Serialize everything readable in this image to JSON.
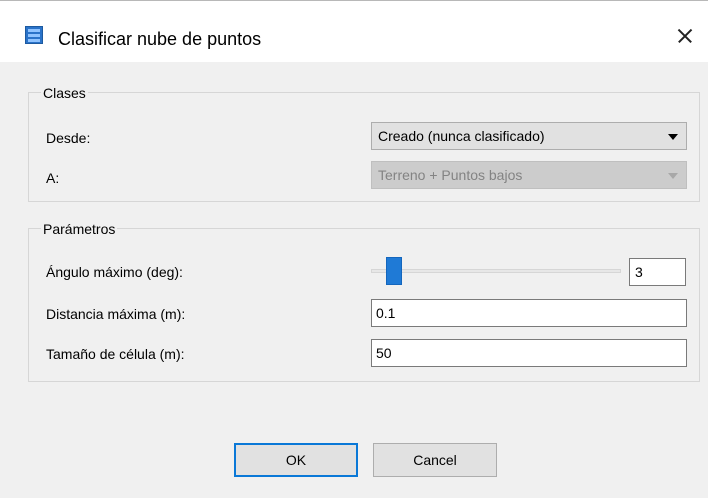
{
  "dialog": {
    "title": "Clasificar nube de puntos",
    "icon": "point-cloud-app-icon"
  },
  "clases": {
    "legend": "Clases",
    "desde_label": "Desde:",
    "desde_value": "Creado (nunca clasificado)",
    "a_label": "A:",
    "a_value": "Terreno + Puntos bajos"
  },
  "parametros": {
    "legend": "Parámetros",
    "angulo_label": "Ángulo máximo (deg):",
    "angulo_value": "3",
    "distancia_label": "Distancia máxima (m):",
    "distancia_value": "0.1",
    "celula_label": "Tamaño de célula (m):",
    "celula_value": "50"
  },
  "buttons": {
    "ok": "OK",
    "cancel": "Cancel"
  },
  "colors": {
    "accent": "#0a78d7",
    "slider_thumb": "#1f7ad6",
    "dialog_bg": "#f0f0f0"
  }
}
